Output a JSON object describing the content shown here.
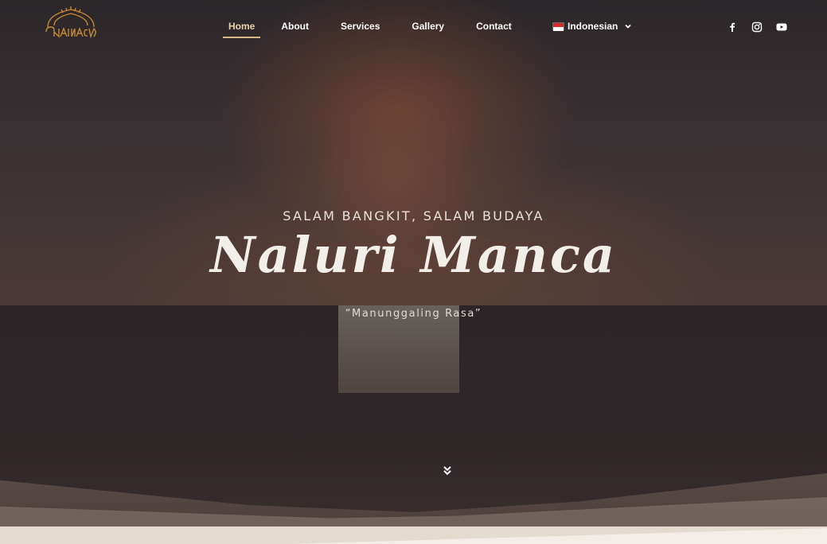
{
  "brand": {
    "logo_text": "NALURI MANCA",
    "logo_color": "#c58a2e"
  },
  "nav": {
    "items": [
      {
        "label": "Home",
        "active": true
      },
      {
        "label": "About",
        "active": false
      },
      {
        "label": "Services",
        "active": false
      },
      {
        "label": "Gallery",
        "active": false
      },
      {
        "label": "Contact",
        "active": false
      }
    ],
    "language": {
      "label": "Indonesian",
      "flag": "indonesia-flag"
    }
  },
  "social": [
    "facebook-icon",
    "instagram-icon",
    "youtube-icon"
  ],
  "hero": {
    "tagline": "SALAM BANGKIT, SALAM BUDAYA",
    "title": "Naluri Manca",
    "subtitle": "“Manunggaling Rasa”",
    "scroll_icon": "double-chevron-down-icon"
  },
  "colors": {
    "accent": "#d5b88c",
    "text_light": "#f2eeea",
    "footer_band": "#e4dbd0"
  }
}
